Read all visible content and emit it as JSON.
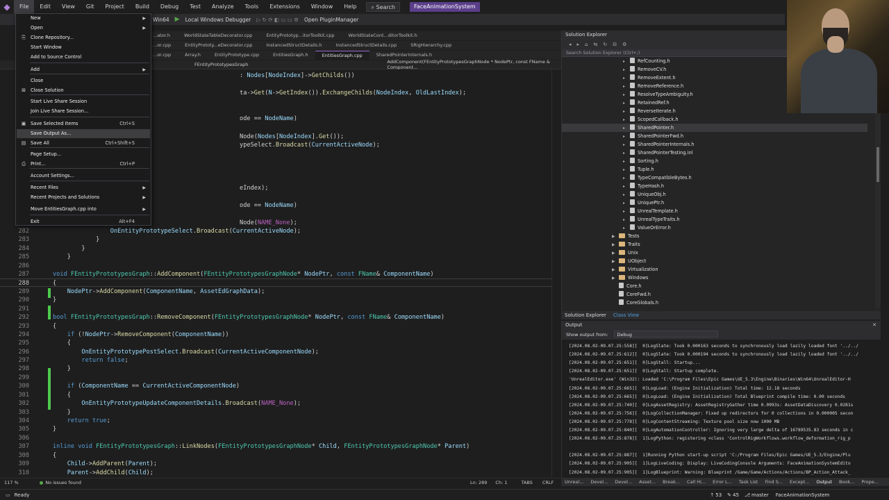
{
  "menubar": {
    "items": [
      "File",
      "Edit",
      "View",
      "Git",
      "Project",
      "Build",
      "Debug",
      "Test",
      "Analyze",
      "Tools",
      "Extensions",
      "Window",
      "Help"
    ],
    "search": "Search",
    "solution_name": "FaceAnimationSystem"
  },
  "toolbar": {
    "platform": "Win64",
    "debugger": "Local Windows Debugger",
    "plugin_manager": "Open PluginManager"
  },
  "tabs_row1": [
    "...ator.h",
    "WorldStateTableDecorator.cpp",
    "EntityPrototyp...itorToolkit.cpp",
    "WorldStateCont...ditorToolkit.h"
  ],
  "tabs_row2": [
    "...or.cpp",
    "EntityPrototy...eDecorator.cpp",
    "InstancedStructDetails.h",
    "InstancedStructDetails.cpp",
    "SRigHierarchy.cpp"
  ],
  "tabs_row3": [
    "...or.cpp",
    "Array.h",
    "EntityPrototype.cpp",
    "EntitiesGraph.h",
    "EntitiesGraph.cpp",
    "SharedPointerInternals.h"
  ],
  "navbar": {
    "scope": "FEntityPrototypesGraph",
    "member": "AddComponent(FEntityPrototypesGraphNode * NodePtr, const FName & Component..."
  },
  "file_menu": {
    "items": [
      {
        "label": "New",
        "submenu": true
      },
      {
        "label": "Open",
        "submenu": true
      },
      {
        "label": "Clone Repository...",
        "icon": "clone"
      },
      {
        "label": "Start Window"
      },
      {
        "label": "Add to Source Control"
      },
      {
        "label": "Add",
        "submenu": true
      },
      {
        "label": "Close"
      },
      {
        "label": "Close Solution",
        "icon": "close-solution"
      },
      {
        "label": "Start Live Share Session"
      },
      {
        "label": "Join Live Share Session..."
      },
      {
        "label": "Save Selected Items",
        "shortcut": "Ctrl+S",
        "icon": "save"
      },
      {
        "label": "Save Output As..."
      },
      {
        "label": "Save All",
        "shortcut": "Ctrl+Shift+S",
        "icon": "save-all"
      },
      {
        "label": "Page Setup..."
      },
      {
        "label": "Print...",
        "shortcut": "Ctrl+P",
        "icon": "print"
      },
      {
        "label": "Account Settings..."
      },
      {
        "label": "Recent Files",
        "submenu": true
      },
      {
        "label": "Recent Projects and Solutions",
        "submenu": true
      },
      {
        "label": "Move EntitiesGraph.cpp into",
        "submenu": true
      },
      {
        "label": "Exit",
        "shortcut": "Alt+F4"
      }
    ]
  },
  "code_lines": [
    {
      "n": "",
      "t": "                                                    : Nodes[NodeIndex]->GetChilds())"
    },
    {
      "n": "",
      "t": "                                                    ta->Get(N->GetIndex()).ExchangeChilds(NodeIndex, OldLastIndex);"
    },
    {
      "n": "",
      "t": "                                                    ode == NodeName)"
    },
    {
      "n": "",
      "t": "                                                    Node(Nodes[NodeIndex].Get());"
    },
    {
      "n": "",
      "t": "                                                    ypeSelect.Broadcast(CurrentActiveNode);"
    },
    {
      "n": "",
      "t": "                                                    eIndex);"
    },
    {
      "n": "",
      "t": "                                                    ode == NodeName)"
    },
    {
      "n": "",
      "t": "                                                    Node(NAME_None);"
    },
    {
      "n": "282",
      "t": "                OnEntityPrototypeSelect.Broadcast(CurrentActiveNode);"
    },
    {
      "n": "283",
      "t": "            }"
    },
    {
      "n": "284",
      "t": "        }"
    },
    {
      "n": "285",
      "t": "    }"
    },
    {
      "n": "286",
      "t": ""
    },
    {
      "n": "287",
      "t": "void FEntityPrototypesGraph::AddComponent(FEntityPrototypesGraphNode* NodePtr, const FName& ComponentName)"
    },
    {
      "n": "288",
      "t": "{"
    },
    {
      "n": "289",
      "t": "    NodePtr->AddComponent(ComponentName, AssetEdGraphData);"
    },
    {
      "n": "290",
      "t": "}"
    },
    {
      "n": "291",
      "t": ""
    },
    {
      "n": "292",
      "t": "bool FEntityPrototypesGraph::RemoveComponent(FEntityPrototypesGraphNode* NodePtr, const FName& ComponentName)"
    },
    {
      "n": "293",
      "t": "{"
    },
    {
      "n": "294",
      "t": "    if (!NodePtr->RemoveComponent(ComponentName))"
    },
    {
      "n": "295",
      "t": "    {"
    },
    {
      "n": "296",
      "t": "        OnEntityPrototypePostSelect.Broadcast(CurrentActiveComponentNode);"
    },
    {
      "n": "297",
      "t": "        return false;"
    },
    {
      "n": "298",
      "t": "    }"
    },
    {
      "n": "299",
      "t": ""
    },
    {
      "n": "300",
      "t": "    if (ComponentName == CurrentActiveComponentNode)"
    },
    {
      "n": "301",
      "t": "    {"
    },
    {
      "n": "302",
      "t": "        OnEntityPrototypeUpdateComponentDetails.Broadcast(NAME_None);"
    },
    {
      "n": "303",
      "t": "    }"
    },
    {
      "n": "304",
      "t": "    return true;"
    },
    {
      "n": "305",
      "t": "}"
    },
    {
      "n": "306",
      "t": ""
    },
    {
      "n": "307",
      "t": "inline void FEntityPrototypesGraph::LinkNodes(FEntityPrototypesGraphNode* Child, FEntityPrototypesGraphNode* Parent)"
    },
    {
      "n": "308",
      "t": "{"
    },
    {
      "n": "309",
      "t": "    Child->AddParent(Parent);"
    },
    {
      "n": "310",
      "t": "    Parent->AddChild(Child);"
    }
  ],
  "editor_status": {
    "zoom": "117 %",
    "issues": "No issues found",
    "line": "Ln: 289",
    "col": "Ch: 1",
    "tabs": "TABS",
    "eol": "CRLF"
  },
  "solution_explorer": {
    "title": "Solution Explorer",
    "search_placeholder": "Search Solution Explorer (Ctrl+;)",
    "items": [
      {
        "label": "RefCounting.h",
        "kind": "file",
        "indent": 2
      },
      {
        "label": "RemoveCV.h",
        "kind": "file",
        "indent": 2
      },
      {
        "label": "RemoveExtent.h",
        "kind": "file",
        "indent": 2
      },
      {
        "label": "RemoveReference.h",
        "kind": "file",
        "indent": 2
      },
      {
        "label": "ResolveTypeAmbiguity.h",
        "kind": "file",
        "indent": 2
      },
      {
        "label": "RetainedRef.h",
        "kind": "file",
        "indent": 2
      },
      {
        "label": "ReverseIterate.h",
        "kind": "file",
        "indent": 2
      },
      {
        "label": "ScopedCallback.h",
        "kind": "file",
        "indent": 2
      },
      {
        "label": "SharedPointer.h",
        "kind": "file",
        "indent": 2,
        "selected": true
      },
      {
        "label": "SharedPointerFwd.h",
        "kind": "file",
        "indent": 2
      },
      {
        "label": "SharedPointerInternals.h",
        "kind": "file",
        "indent": 2
      },
      {
        "label": "SharedPointerTesting.inl",
        "kind": "file",
        "indent": 2
      },
      {
        "label": "Sorting.h",
        "kind": "file",
        "indent": 2
      },
      {
        "label": "Tuple.h",
        "kind": "file",
        "indent": 2
      },
      {
        "label": "TypeCompatibleBytes.h",
        "kind": "file",
        "indent": 2
      },
      {
        "label": "TypeHash.h",
        "kind": "file",
        "indent": 2
      },
      {
        "label": "UniqueObj.h",
        "kind": "file",
        "indent": 2
      },
      {
        "label": "UniquePtr.h",
        "kind": "file",
        "indent": 2
      },
      {
        "label": "UnrealTemplate.h",
        "kind": "file",
        "indent": 2
      },
      {
        "label": "UnrealTypeTraits.h",
        "kind": "file",
        "indent": 2
      },
      {
        "label": "ValueOrError.h",
        "kind": "file",
        "indent": 2
      },
      {
        "label": "Tests",
        "kind": "folder",
        "indent": 1
      },
      {
        "label": "Traits",
        "kind": "folder",
        "indent": 1
      },
      {
        "label": "Unix",
        "kind": "folder",
        "indent": 1
      },
      {
        "label": "UObject",
        "kind": "folder",
        "indent": 1
      },
      {
        "label": "Virtualization",
        "kind": "folder",
        "indent": 1
      },
      {
        "label": "Windows",
        "kind": "folder",
        "indent": 1
      },
      {
        "label": "Core.h",
        "kind": "file",
        "indent": 1
      },
      {
        "label": "CoreFwd.h",
        "kind": "file",
        "indent": 1
      },
      {
        "label": "CoreGlobals.h",
        "kind": "file",
        "indent": 1
      }
    ],
    "tabs": [
      "Solution Explorer",
      "Class View"
    ]
  },
  "output": {
    "title": "Output",
    "source_label": "Show output from:",
    "source_value": "Debug",
    "lines": [
      "[2024.08.02-09.07.25:558][  0]LogSlate: Took 0.000163 seconds to synchronously load lazily loaded font '../../",
      "[2024.08.02-09.07.25:612][  0]LogSlate: Took 0.000194 seconds to synchronously load lazily loaded font '../../",
      "[2024.08.02-09.07.25:651][  0]LogStall: Startup...",
      "[2024.08.02-09.07.25:651][  0]LogStall: Startup complete.",
      "'UnrealEditor.exe' (Win32): Loaded 'C:\\Program Files\\Epic Games\\UE_5.3\\Engine\\Binaries\\Win64\\UnrealEditor-H",
      "[2024.08.02-09.07.25:665][  0]LogLoad: (Engine Initialization) Total time: 12.18 seconds",
      "[2024.08.02-09.07.25:665][  0]LogLoad: (Engine Initialization) Total Blueprint compile time: 0.00 seconds",
      "[2024.08.02-09.07.25:740][  0]LogAssetRegistry: AssetRegistryGather time 0.0993s: AssetDataDiscovery 0.0281s",
      "[2024.08.02-09.07.25:756][  0]LogCollectionManager: Fixed up redirectors for 0 collections in 0.000005 secon",
      "[2024.08.02-09.07.25:778][  0]LogContentStreaming: Texture pool size now 1000 MB",
      "[2024.08.02-09.07.25:840][  0]LogAutomationController: Ignoring very large delta of 16789535.83 seconds in c",
      "[2024.08.02-09.07.25:878][  1]LogPython: registering <class 'ControlRigWorkflows.workflow_deformation_rig_p",
      "",
      "[2024.08.02-09.07.25:887][  1]Running Python start-up script 'C:/Program Files/Epic Games/UE_5.3/Engine/Plu",
      "[2024.08.02-09.07.25:905][  1]LogLiveCoding: Display: LiveCodingConsole Arguments: FaceAnimationSystemEdito",
      "[2024.08.02-09.07.25:905][  1]LogBlueprint: Warning: Blueprint /Game/Game/Actions/Actions/BP_Action_Attack_",
      "[2024.08.02-09.07.27:937][174]LogSlate: Took 0.000102 seconds to synchronously load lazily loaded font '../.",
      "[2024.08.02-09.07.57:525][174]LogAutomationController: Ignoring very large delta of 29.60 seconds in calls t",
      "[2024.08.02-09.07.57:525][174]LogSlate: Took 0.000105 seconds to synchronously load lazily loaded font '../.",
      "[2024.08.02-09.07.32:525][174]LogEditorSubsystem: Opening Asset editor for EntityPrototypes /Game/ECSAB"
    ]
  },
  "bottom_tabs": [
    "Unreal...",
    "Devel...",
    "Devel...",
    "Asset...",
    "Break...",
    "Call Hi...",
    "Error L...",
    "Task List",
    "Find S...",
    "Except...",
    "Output",
    "Book...",
    "Prope..."
  ],
  "statusbar": {
    "ready": "Ready",
    "count1": "53",
    "count2": "45",
    "branch": "master",
    "repo": "FaceAnimationSystem"
  }
}
